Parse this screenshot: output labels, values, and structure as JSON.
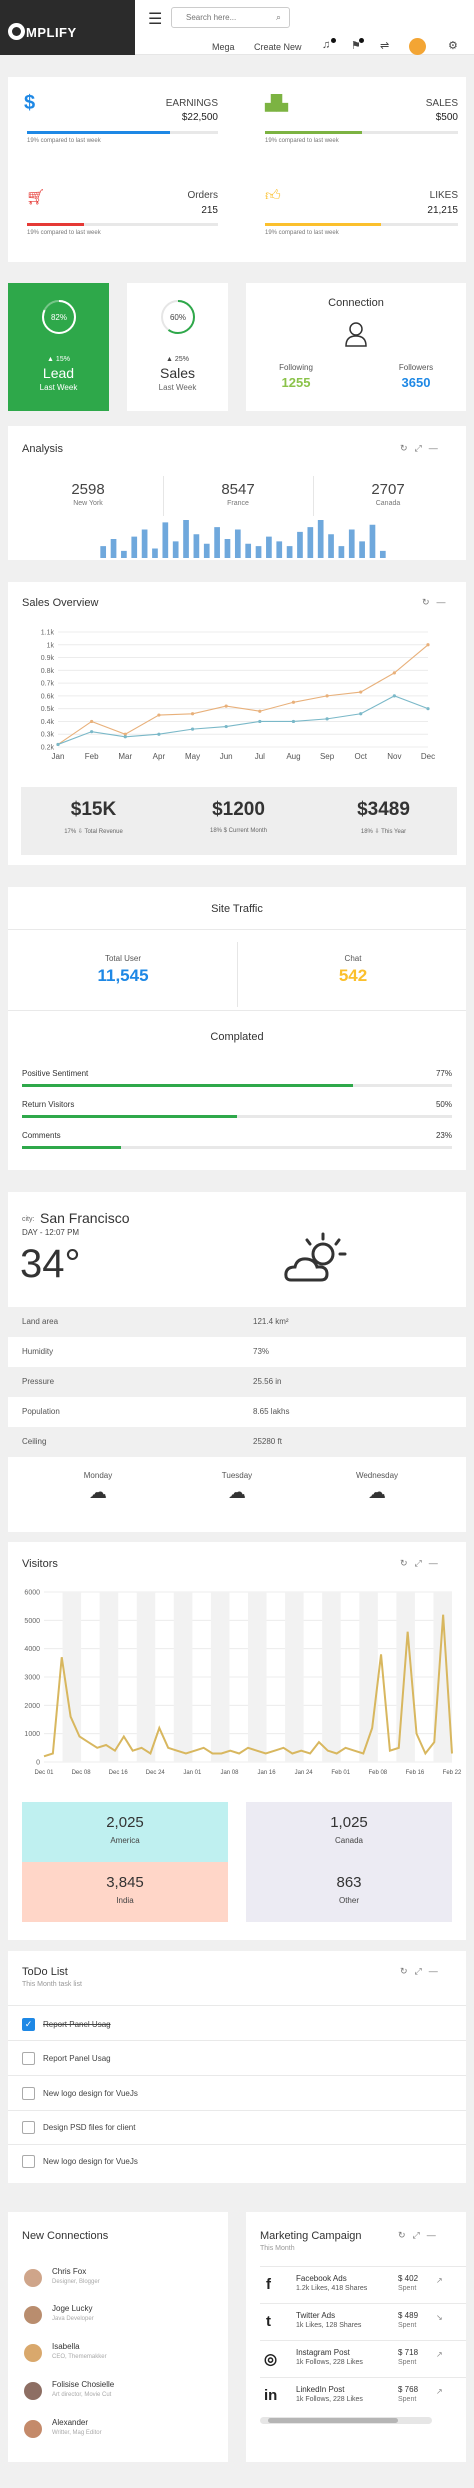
{
  "brand": {
    "name": "MPLIFY"
  },
  "search": {
    "placeholder": "Search here..."
  },
  "nav": {
    "mega": "Mega",
    "create_new": "Create New"
  },
  "stats": [
    {
      "label": "EARNINGS",
      "value": "$22,500",
      "note": "19% compared to last week",
      "icon": "dollar-icon",
      "color": "#1e88e5",
      "progress": 0.75
    },
    {
      "label": "SALES",
      "value": "$500",
      "note": "19% compared to last week",
      "icon": "bar-chart-icon",
      "color": "#7cb342",
      "progress": 0.5
    },
    {
      "label": "Orders",
      "value": "215",
      "note": "19% compared to last week",
      "icon": "cart-icon",
      "color": "#e53935",
      "progress": 0.3
    },
    {
      "label": "LIKES",
      "value": "21,215",
      "note": "19% compared to last week",
      "icon": "thumbs-up-icon",
      "color": "#fbc02d",
      "progress": 0.6
    }
  ],
  "lead": {
    "percent": "82%",
    "change": "▲ 15%",
    "title": "Lead",
    "sub": "Last Week",
    "progress": 0.82
  },
  "salesw": {
    "percent": "60%",
    "change": "▲ 25%",
    "title": "Sales",
    "sub": "Last Week",
    "progress": 0.6
  },
  "connection": {
    "title": "Connection",
    "following_label": "Following",
    "following": "1255",
    "followers_label": "Followers",
    "followers": "3650"
  },
  "analysis": {
    "title": "Analysis",
    "cols": [
      {
        "value": "2598",
        "label": "New York"
      },
      {
        "value": "8547",
        "label": "France"
      },
      {
        "value": "2707",
        "label": "Canada"
      }
    ]
  },
  "sales_overview": {
    "title": "Sales Overview",
    "summary": [
      {
        "value": "$15K",
        "label": "17% ⇩ Total Revenue"
      },
      {
        "value": "$1200",
        "label": "18% $ Current Month"
      },
      {
        "value": "$3489",
        "label": "18% ⇩ This Year"
      }
    ]
  },
  "chart_data": [
    {
      "type": "bar",
      "values": [
        5,
        8,
        3,
        9,
        12,
        4,
        15,
        7,
        16,
        10,
        6,
        13,
        8,
        12,
        6,
        5,
        9,
        7,
        5,
        11,
        13,
        16,
        10,
        5,
        12,
        7,
        14,
        3
      ],
      "color": "#6fa8dc"
    },
    {
      "type": "line",
      "title": "Sales Overview",
      "categories": [
        "Jan",
        "Feb",
        "Mar",
        "Apr",
        "May",
        "Jun",
        "Jul",
        "Aug",
        "Sep",
        "Oct",
        "Nov",
        "Dec"
      ],
      "y_ticks": [
        "0.2k",
        "0.3k",
        "0.4k",
        "0.5k",
        "0.6k",
        "0.7k",
        "0.8k",
        "0.9k",
        "1k",
        "1.1k"
      ],
      "ylim": [
        0.2,
        1.1
      ],
      "series": [
        {
          "color": "#e8b07a",
          "values": [
            0.22,
            0.4,
            0.3,
            0.45,
            0.46,
            0.52,
            0.48,
            0.55,
            0.6,
            0.63,
            0.78,
            1.0
          ]
        },
        {
          "color": "#7ab8c8",
          "values": [
            0.22,
            0.32,
            0.28,
            0.3,
            0.34,
            0.36,
            0.4,
            0.4,
            0.42,
            0.46,
            0.6,
            0.5
          ]
        }
      ]
    },
    {
      "type": "line",
      "title": "Visitors",
      "categories": [
        "Dec 01",
        "Dec 08",
        "Dec 16",
        "Dec 24",
        "Jan 01",
        "Jan 08",
        "Jan 16",
        "Jan 24",
        "Feb 01",
        "Feb 08",
        "Feb 16",
        "Feb 22"
      ],
      "y_ticks": [
        "0",
        "1000",
        "2000",
        "3000",
        "4000",
        "5000",
        "6000"
      ],
      "ylim": [
        0,
        6000
      ],
      "series": [
        {
          "color": "#d8b75f",
          "values": [
            200,
            300,
            3700,
            1600,
            900,
            700,
            500,
            600,
            400,
            900,
            400,
            500,
            300,
            1200,
            500,
            400,
            300,
            400,
            500,
            300,
            300,
            400,
            300,
            500,
            400,
            300,
            400,
            500,
            300,
            400,
            300,
            700,
            400,
            300,
            500,
            400,
            300,
            1200,
            3800,
            400,
            500,
            4600,
            1000,
            300,
            700,
            5200,
            300
          ]
        }
      ]
    }
  ],
  "traffic": {
    "title": "Site Traffic",
    "total_user_label": "Total User",
    "total_user": "11,545",
    "chat_label": "Chat",
    "chat": "542",
    "completed_title": "Complated",
    "rows": [
      {
        "label": "Positive Sentiment",
        "value": "77%",
        "progress": 0.77
      },
      {
        "label": "Return Visitors",
        "value": "50%",
        "progress": 0.5
      },
      {
        "label": "Comments",
        "value": "23%",
        "progress": 0.23
      }
    ]
  },
  "weather": {
    "city_prefix": "city:",
    "city": "San Francisco",
    "time": "DAY - 12:07 PM",
    "temp": "34°",
    "rows": [
      {
        "label": "Land area",
        "value": "121.4 km²"
      },
      {
        "label": "Humidity",
        "value": "73%"
      },
      {
        "label": "Pressure",
        "value": "25.56 in"
      },
      {
        "label": "Population",
        "value": "8.65 lakhs"
      },
      {
        "label": "Ceiling",
        "value": "25280 ft"
      }
    ],
    "days": [
      "Monday",
      "Tuesday",
      "Wednesday"
    ]
  },
  "visitors": {
    "title": "Visitors",
    "tiles": [
      {
        "value": "2,025",
        "label": "America",
        "color": "#bff0f0"
      },
      {
        "value": "1,025",
        "label": "Canada",
        "color": "#ecebf3"
      },
      {
        "value": "3,845",
        "label": "India",
        "color": "#ffd6c8"
      },
      {
        "value": "863",
        "label": "Other",
        "color": "#ecebf3"
      }
    ]
  },
  "todo": {
    "title": "ToDo List",
    "sub": "This Month task list",
    "items": [
      {
        "label": "Report Panel Usag",
        "checked": true
      },
      {
        "label": "Report Panel Usag",
        "checked": false
      },
      {
        "label": "New logo design for VueJs",
        "checked": false
      },
      {
        "label": "Design PSD files for client",
        "checked": false
      },
      {
        "label": "New logo design for VueJs",
        "checked": false
      }
    ]
  },
  "connections": {
    "title": "New Connections",
    "people": [
      {
        "name": "Chris Fox",
        "role": "Designer, Blogger"
      },
      {
        "name": "Joge Lucky",
        "role": "Java Developer"
      },
      {
        "name": "Isabella",
        "role": "CEO, Thememakker"
      },
      {
        "name": "Folisise Chosielle",
        "role": "Art director, Movie Cut"
      },
      {
        "name": "Alexander",
        "role": "Writter, Mag Editor"
      }
    ]
  },
  "marketing": {
    "title": "Marketing Campaign",
    "sub": "This Month",
    "rows": [
      {
        "name": "Facebook Ads",
        "stats": "1.2k Likes, 418 Shares",
        "amount": "$ 402",
        "spent": "Spent",
        "icon": "facebook-icon",
        "glyph": "f"
      },
      {
        "name": "Twitter Ads",
        "stats": "1k Likes, 128 Shares",
        "amount": "$ 489",
        "spent": "Spent",
        "icon": "twitter-icon",
        "glyph": "t"
      },
      {
        "name": "Instagram Post",
        "stats": "1k Follows, 228 Likes",
        "amount": "$ 718",
        "spent": "Spent",
        "icon": "instagram-icon",
        "glyph": "◎"
      },
      {
        "name": "LinkedIn Post",
        "stats": "1k Follows, 228 Likes",
        "amount": "$ 768",
        "spent": "Spent",
        "icon": "linkedin-icon",
        "glyph": "in"
      }
    ]
  }
}
